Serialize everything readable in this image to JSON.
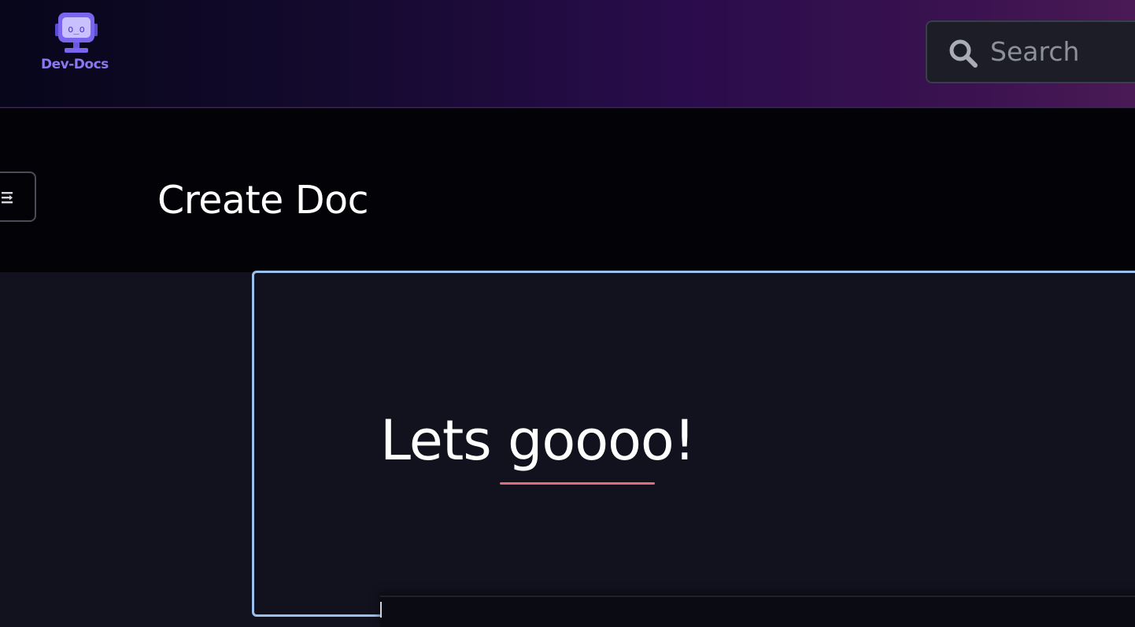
{
  "header": {
    "logo_text": "Dev-Docs",
    "search": {
      "placeholder": "Search"
    }
  },
  "titlebar": {
    "title": "Create Doc"
  },
  "editor": {
    "heading": "Lets goooo!",
    "misspelled_word": "goooo"
  },
  "colors": {
    "header_gradient_start": "#07061a",
    "header_gradient_end": "#4a1a55",
    "logo_accent": "#8a78f0",
    "editor_border_focus": "#9cc0ee",
    "spellcheck_underline": "#e26b7d",
    "background": "#12121e"
  },
  "icons": {
    "logo": "robot-monitor-icon",
    "search": "search-icon",
    "menu_toggle": "sidebar-toggle-icon"
  }
}
